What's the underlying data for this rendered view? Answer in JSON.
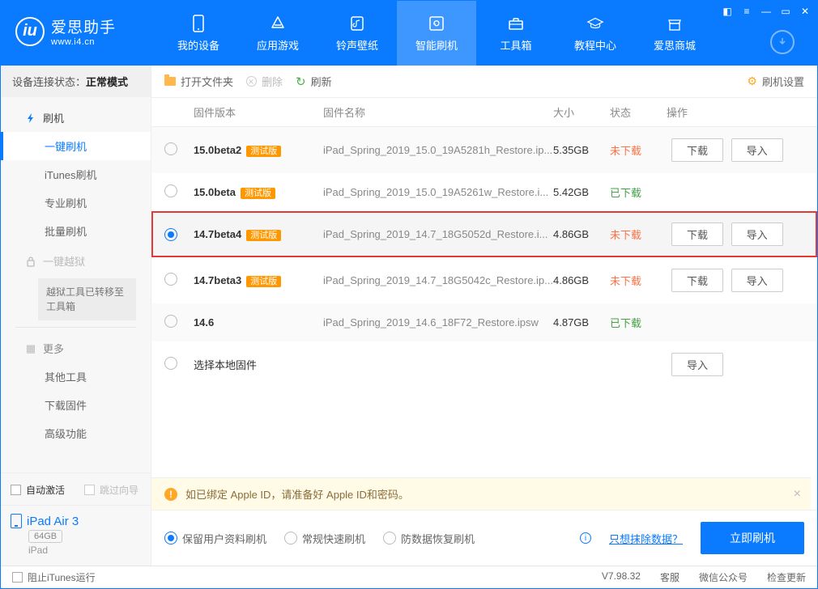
{
  "app": {
    "name_cn": "爱思助手",
    "name_en": "www.i4.cn"
  },
  "nav": {
    "items": [
      {
        "label": "我的设备"
      },
      {
        "label": "应用游戏"
      },
      {
        "label": "铃声壁纸"
      },
      {
        "label": "智能刷机"
      },
      {
        "label": "工具箱"
      },
      {
        "label": "教程中心"
      },
      {
        "label": "爱思商城"
      }
    ]
  },
  "sidebar": {
    "conn_label": "设备连接状态：",
    "conn_value": "正常模式",
    "groups": {
      "flash": {
        "title": "刷机",
        "items": [
          "一键刷机",
          "iTunes刷机",
          "专业刷机",
          "批量刷机"
        ]
      },
      "jailbreak": {
        "title": "一键越狱",
        "note": "越狱工具已转移至工具箱"
      },
      "more": {
        "title": "更多",
        "items": [
          "其他工具",
          "下载固件",
          "高级功能"
        ]
      }
    },
    "footer": {
      "auto_activate": "自动激活",
      "skip_guide": "跳过向导",
      "device_name": "iPad Air 3",
      "device_storage": "64GB",
      "device_type": "iPad"
    }
  },
  "toolbar": {
    "open_folder": "打开文件夹",
    "delete": "删除",
    "refresh": "刷新",
    "settings": "刷机设置"
  },
  "table": {
    "headers": {
      "version": "固件版本",
      "name": "固件名称",
      "size": "大小",
      "status": "状态",
      "ops": "操作"
    },
    "btn_download": "下载",
    "btn_import": "导入",
    "badge_beta": "测试版",
    "local_row": "选择本地固件",
    "rows": [
      {
        "version": "15.0beta2",
        "beta": true,
        "name": "iPad_Spring_2019_15.0_19A5281h_Restore.ip...",
        "size": "5.35GB",
        "status": "未下载",
        "status_type": "not",
        "checked": false,
        "show_dl": true,
        "show_imp": true
      },
      {
        "version": "15.0beta",
        "beta": true,
        "name": "iPad_Spring_2019_15.0_19A5261w_Restore.i...",
        "size": "5.42GB",
        "status": "已下载",
        "status_type": "done",
        "checked": false,
        "show_dl": false,
        "show_imp": false
      },
      {
        "version": "14.7beta4",
        "beta": true,
        "name": "iPad_Spring_2019_14.7_18G5052d_Restore.i...",
        "size": "4.86GB",
        "status": "未下载",
        "status_type": "not",
        "checked": true,
        "show_dl": true,
        "show_imp": true,
        "highlight": true
      },
      {
        "version": "14.7beta3",
        "beta": true,
        "name": "iPad_Spring_2019_14.7_18G5042c_Restore.ip...",
        "size": "4.86GB",
        "status": "未下载",
        "status_type": "not",
        "checked": false,
        "show_dl": true,
        "show_imp": true
      },
      {
        "version": "14.6",
        "beta": false,
        "name": "iPad_Spring_2019_14.6_18F72_Restore.ipsw",
        "size": "4.87GB",
        "status": "已下载",
        "status_type": "done",
        "checked": false,
        "show_dl": false,
        "show_imp": false
      }
    ]
  },
  "notice": {
    "text": "如已绑定 Apple ID，请准备好 Apple ID和密码。"
  },
  "modes": {
    "keep_data": "保留用户资料刷机",
    "normal": "常规快速刷机",
    "recovery": "防数据恢复刷机",
    "erase_link": "只想抹除数据？",
    "start": "立即刷机"
  },
  "statusbar": {
    "block_itunes": "阻止iTunes运行",
    "version": "V7.98.32",
    "support": "客服",
    "wechat": "微信公众号",
    "update": "检查更新"
  }
}
